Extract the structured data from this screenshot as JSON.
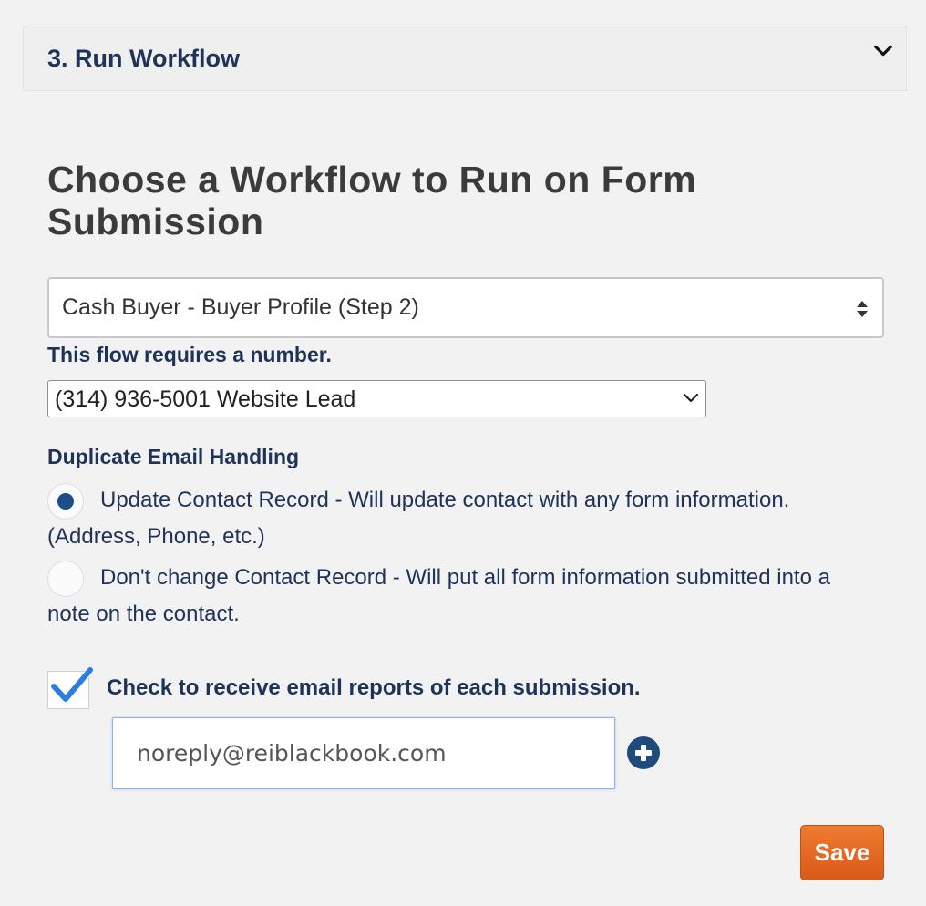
{
  "section": {
    "title": "3. Run Workflow",
    "toggle_icon": "chevron-down-icon"
  },
  "main": {
    "heading": "Choose a Workflow to Run on Form Submission",
    "workflow_select": {
      "selected": "Cash Buyer - Buyer Profile (Step 2)"
    },
    "requires_number_text": "This flow requires a number.",
    "number_select": {
      "selected": "(314) 936-5001 Website Lead"
    },
    "duplicate_email": {
      "label": "Duplicate Email Handling",
      "options": [
        {
          "label": "Update Contact Record - Will update contact with any form information. (Address, Phone, etc.)",
          "selected": true
        },
        {
          "label": "Don't change Contact Record - Will put all form information submitted into a note on the contact.",
          "selected": false
        }
      ]
    },
    "email_reports": {
      "checked": true,
      "label": "Check to receive email reports of each submission.",
      "email_value": "noreply@reiblackbook.com",
      "add_icon": "plus-circle-icon"
    },
    "save_label": "Save"
  },
  "colors": {
    "navy_text": "#1f3358",
    "radio_selected": "#1d4f86",
    "checkmark": "#2b7de0",
    "save_button": "#e8692a",
    "add_button": "#1e4a7c"
  }
}
